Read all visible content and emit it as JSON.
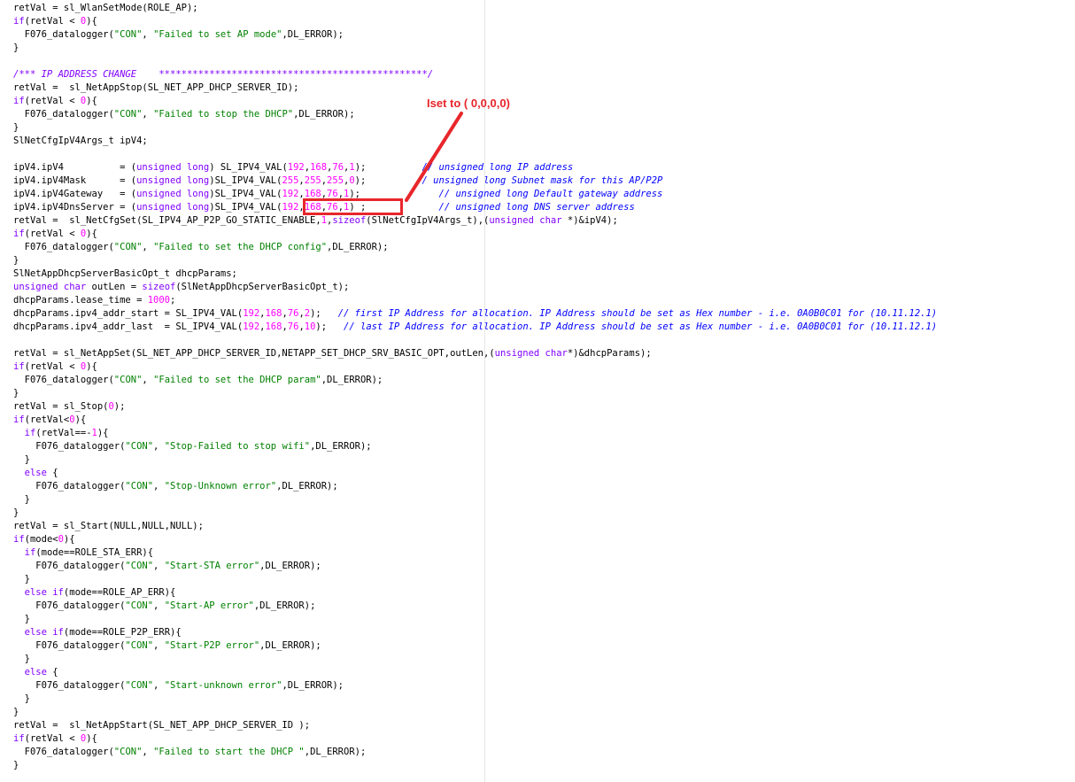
{
  "annotation": {
    "text": "Iset to ( 0,0,0,0)",
    "color": "#e8262b"
  },
  "colors": {
    "keyword": "#8000ff",
    "number": "#ff00ff",
    "string": "#008000",
    "comment": "#0000ff",
    "block_comment": "#8000ff"
  },
  "code_lines": [
    [
      [
        "retVal = sl_WlanSetMode(ROLE_AP);",
        "plain"
      ]
    ],
    [
      [
        "if",
        "kw"
      ],
      [
        "(retVal < ",
        "plain"
      ],
      [
        "0",
        "num"
      ],
      [
        "){",
        "plain"
      ]
    ],
    [
      [
        "  F076_datalogger(",
        "plain"
      ],
      [
        "\"CON\"",
        "str"
      ],
      [
        ", ",
        "plain"
      ],
      [
        "\"Failed to set AP mode\"",
        "str"
      ],
      [
        ",DL_ERROR);",
        "plain"
      ]
    ],
    [
      [
        "}",
        "plain"
      ]
    ],
    [
      [
        "",
        "plain"
      ]
    ],
    [
      [
        "/*** IP ADDRESS CHANGE    ************************************************/",
        "cmt-alt"
      ]
    ],
    [
      [
        "retVal =  sl_NetAppStop(SL_NET_APP_DHCP_SERVER_ID);",
        "plain"
      ]
    ],
    [
      [
        "if",
        "kw"
      ],
      [
        "(retVal < ",
        "plain"
      ],
      [
        "0",
        "num"
      ],
      [
        "){",
        "plain"
      ]
    ],
    [
      [
        "  F076_datalogger(",
        "plain"
      ],
      [
        "\"CON\"",
        "str"
      ],
      [
        ", ",
        "plain"
      ],
      [
        "\"Failed to stop the DHCP\"",
        "str"
      ],
      [
        ",DL_ERROR);",
        "plain"
      ]
    ],
    [
      [
        "}",
        "plain"
      ]
    ],
    [
      [
        "SlNetCfgIpV4Args_t ipV4;",
        "plain"
      ]
    ],
    [
      [
        "",
        "plain"
      ]
    ],
    [
      [
        "ipV4.ipV4          = (",
        "plain"
      ],
      [
        "unsigned long",
        "kw"
      ],
      [
        ") SL_IPV4_VAL(",
        "plain"
      ],
      [
        "192",
        "num"
      ],
      [
        ",",
        "plain"
      ],
      [
        "168",
        "num"
      ],
      [
        ",",
        "plain"
      ],
      [
        "76",
        "num"
      ],
      [
        ",",
        "plain"
      ],
      [
        "1",
        "num"
      ],
      [
        ");          ",
        "plain"
      ],
      [
        "// unsigned long IP address",
        "cmt"
      ]
    ],
    [
      [
        "ipV4.ipV4Mask      = (",
        "plain"
      ],
      [
        "unsigned long",
        "kw"
      ],
      [
        ")SL_IPV4_VAL(",
        "plain"
      ],
      [
        "255",
        "num"
      ],
      [
        ",",
        "plain"
      ],
      [
        "255",
        "num"
      ],
      [
        ",",
        "plain"
      ],
      [
        "255",
        "num"
      ],
      [
        ",",
        "plain"
      ],
      [
        "0",
        "num"
      ],
      [
        ");         ",
        "plain"
      ],
      [
        "// unsigned long Subnet mask for this AP/P2P",
        "cmt"
      ]
    ],
    [
      [
        "ipV4.ipV4Gateway   = (",
        "plain"
      ],
      [
        "unsigned long",
        "kw"
      ],
      [
        ")SL_IPV4_VAL(",
        "plain"
      ],
      [
        "192",
        "num"
      ],
      [
        ",",
        "plain"
      ],
      [
        "168",
        "num"
      ],
      [
        ",",
        "plain"
      ],
      [
        "76",
        "num"
      ],
      [
        ",",
        "plain"
      ],
      [
        "1",
        "num"
      ],
      [
        ");              ",
        "plain"
      ],
      [
        "// unsigned long Default gateway address",
        "cmt"
      ]
    ],
    [
      [
        "ipV4.ipV4DnsServer = (",
        "plain"
      ],
      [
        "unsigned long",
        "kw"
      ],
      [
        ")SL_IPV4_VAL(",
        "plain"
      ],
      [
        "192",
        "num"
      ],
      [
        ",",
        "plain"
      ],
      [
        "168",
        "num"
      ],
      [
        ",",
        "plain"
      ],
      [
        "76",
        "num"
      ],
      [
        ",",
        "plain"
      ],
      [
        "1",
        "num"
      ],
      [
        ") ;             ",
        "plain"
      ],
      [
        "// unsigned long DNS server address",
        "cmt"
      ]
    ],
    [
      [
        "retVal =  sl_NetCfgSet(SL_IPV4_AP_P2P_GO_STATIC_ENABLE,",
        "plain"
      ],
      [
        "1",
        "num"
      ],
      [
        ",",
        "plain"
      ],
      [
        "sizeof",
        "kw"
      ],
      [
        "(SlNetCfgIpV4Args_t),(",
        "plain"
      ],
      [
        "unsigned char",
        "kw"
      ],
      [
        " *)&ipV4);",
        "plain"
      ]
    ],
    [
      [
        "if",
        "kw"
      ],
      [
        "(retVal < ",
        "plain"
      ],
      [
        "0",
        "num"
      ],
      [
        "){",
        "plain"
      ]
    ],
    [
      [
        "  F076_datalogger(",
        "plain"
      ],
      [
        "\"CON\"",
        "str"
      ],
      [
        ", ",
        "plain"
      ],
      [
        "\"Failed to set the DHCP config\"",
        "str"
      ],
      [
        ",DL_ERROR);",
        "plain"
      ]
    ],
    [
      [
        "}",
        "plain"
      ]
    ],
    [
      [
        "SlNetAppDhcpServerBasicOpt_t dhcpParams;",
        "plain"
      ]
    ],
    [
      [
        "unsigned char",
        "kw"
      ],
      [
        " outLen = ",
        "plain"
      ],
      [
        "sizeof",
        "kw"
      ],
      [
        "(SlNetAppDhcpServerBasicOpt_t);",
        "plain"
      ]
    ],
    [
      [
        "dhcpParams.lease_time = ",
        "plain"
      ],
      [
        "1000",
        "num"
      ],
      [
        ";",
        "plain"
      ]
    ],
    [
      [
        "dhcpParams.ipv4_addr_start = SL_IPV4_VAL(",
        "plain"
      ],
      [
        "192",
        "num"
      ],
      [
        ",",
        "plain"
      ],
      [
        "168",
        "num"
      ],
      [
        ",",
        "plain"
      ],
      [
        "76",
        "num"
      ],
      [
        ",",
        "plain"
      ],
      [
        "2",
        "num"
      ],
      [
        ");   ",
        "plain"
      ],
      [
        "// first IP Address for allocation. IP Address should be set as Hex number - i.e. 0A0B0C01 for (10.11.12.1)",
        "cmt"
      ]
    ],
    [
      [
        "dhcpParams.ipv4_addr_last  = SL_IPV4_VAL(",
        "plain"
      ],
      [
        "192",
        "num"
      ],
      [
        ",",
        "plain"
      ],
      [
        "168",
        "num"
      ],
      [
        ",",
        "plain"
      ],
      [
        "76",
        "num"
      ],
      [
        ",",
        "plain"
      ],
      [
        "10",
        "num"
      ],
      [
        ");   ",
        "plain"
      ],
      [
        "// last IP Address for allocation. IP Address should be set as Hex number - i.e. 0A0B0C01 for (10.11.12.1)",
        "cmt"
      ]
    ],
    [
      [
        "",
        "plain"
      ]
    ],
    [
      [
        "retVal = sl_NetAppSet(SL_NET_APP_DHCP_SERVER_ID,NETAPP_SET_DHCP_SRV_BASIC_OPT,outLen,(",
        "plain"
      ],
      [
        "unsigned char",
        "kw"
      ],
      [
        "*)&dhcpParams);",
        "plain"
      ]
    ],
    [
      [
        "if",
        "kw"
      ],
      [
        "(retVal < ",
        "plain"
      ],
      [
        "0",
        "num"
      ],
      [
        "){",
        "plain"
      ]
    ],
    [
      [
        "  F076_datalogger(",
        "plain"
      ],
      [
        "\"CON\"",
        "str"
      ],
      [
        ", ",
        "plain"
      ],
      [
        "\"Failed to set the DHCP param\"",
        "str"
      ],
      [
        ",DL_ERROR);",
        "plain"
      ]
    ],
    [
      [
        "}",
        "plain"
      ]
    ],
    [
      [
        "retVal = sl_Stop(",
        "plain"
      ],
      [
        "0",
        "num"
      ],
      [
        ");",
        "plain"
      ]
    ],
    [
      [
        "if",
        "kw"
      ],
      [
        "(retVal<",
        "plain"
      ],
      [
        "0",
        "num"
      ],
      [
        "){",
        "plain"
      ]
    ],
    [
      [
        "  ",
        "plain"
      ],
      [
        "if",
        "kw"
      ],
      [
        "(retVal==-",
        "plain"
      ],
      [
        "1",
        "num"
      ],
      [
        "){",
        "plain"
      ]
    ],
    [
      [
        "    F076_datalogger(",
        "plain"
      ],
      [
        "\"CON\"",
        "str"
      ],
      [
        ", ",
        "plain"
      ],
      [
        "\"Stop-Failed to stop wifi\"",
        "str"
      ],
      [
        ",DL_ERROR);",
        "plain"
      ]
    ],
    [
      [
        "  }",
        "plain"
      ]
    ],
    [
      [
        "  ",
        "plain"
      ],
      [
        "else",
        "kw"
      ],
      [
        " {",
        "plain"
      ]
    ],
    [
      [
        "    F076_datalogger(",
        "plain"
      ],
      [
        "\"CON\"",
        "str"
      ],
      [
        ", ",
        "plain"
      ],
      [
        "\"Stop-Unknown error\"",
        "str"
      ],
      [
        ",DL_ERROR);",
        "plain"
      ]
    ],
    [
      [
        "  }",
        "plain"
      ]
    ],
    [
      [
        "}",
        "plain"
      ]
    ],
    [
      [
        "retVal = sl_Start(NULL,NULL,NULL);",
        "plain"
      ]
    ],
    [
      [
        "if",
        "kw"
      ],
      [
        "(mode<",
        "plain"
      ],
      [
        "0",
        "num"
      ],
      [
        "){",
        "plain"
      ]
    ],
    [
      [
        "  ",
        "plain"
      ],
      [
        "if",
        "kw"
      ],
      [
        "(mode==ROLE_STA_ERR){",
        "plain"
      ]
    ],
    [
      [
        "    F076_datalogger(",
        "plain"
      ],
      [
        "\"CON\"",
        "str"
      ],
      [
        ", ",
        "plain"
      ],
      [
        "\"Start-STA error\"",
        "str"
      ],
      [
        ",DL_ERROR);",
        "plain"
      ]
    ],
    [
      [
        "  }",
        "plain"
      ]
    ],
    [
      [
        "  ",
        "plain"
      ],
      [
        "else if",
        "kw"
      ],
      [
        "(mode==ROLE_AP_ERR){",
        "plain"
      ]
    ],
    [
      [
        "    F076_datalogger(",
        "plain"
      ],
      [
        "\"CON\"",
        "str"
      ],
      [
        ", ",
        "plain"
      ],
      [
        "\"Start-AP error\"",
        "str"
      ],
      [
        ",DL_ERROR);",
        "plain"
      ]
    ],
    [
      [
        "  }",
        "plain"
      ]
    ],
    [
      [
        "  ",
        "plain"
      ],
      [
        "else if",
        "kw"
      ],
      [
        "(mode==ROLE_P2P_ERR){",
        "plain"
      ]
    ],
    [
      [
        "    F076_datalogger(",
        "plain"
      ],
      [
        "\"CON\"",
        "str"
      ],
      [
        ", ",
        "plain"
      ],
      [
        "\"Start-P2P error\"",
        "str"
      ],
      [
        ",DL_ERROR);",
        "plain"
      ]
    ],
    [
      [
        "  }",
        "plain"
      ]
    ],
    [
      [
        "  ",
        "plain"
      ],
      [
        "else",
        "kw"
      ],
      [
        " {",
        "plain"
      ]
    ],
    [
      [
        "    F076_datalogger(",
        "plain"
      ],
      [
        "\"CON\"",
        "str"
      ],
      [
        ", ",
        "plain"
      ],
      [
        "\"Start-unknown error\"",
        "str"
      ],
      [
        ",DL_ERROR);",
        "plain"
      ]
    ],
    [
      [
        "  }",
        "plain"
      ]
    ],
    [
      [
        "}",
        "plain"
      ]
    ],
    [
      [
        "retVal =  sl_NetAppStart(SL_NET_APP_DHCP_SERVER_ID );",
        "plain"
      ]
    ],
    [
      [
        "if",
        "kw"
      ],
      [
        "(retVal < ",
        "plain"
      ],
      [
        "0",
        "num"
      ],
      [
        "){",
        "plain"
      ]
    ],
    [
      [
        "  F076_datalogger(",
        "plain"
      ],
      [
        "\"CON\"",
        "str"
      ],
      [
        ", ",
        "plain"
      ],
      [
        "\"Failed to start the DHCP \"",
        "str"
      ],
      [
        ",DL_ERROR);",
        "plain"
      ]
    ],
    [
      [
        "}",
        "plain"
      ]
    ]
  ]
}
